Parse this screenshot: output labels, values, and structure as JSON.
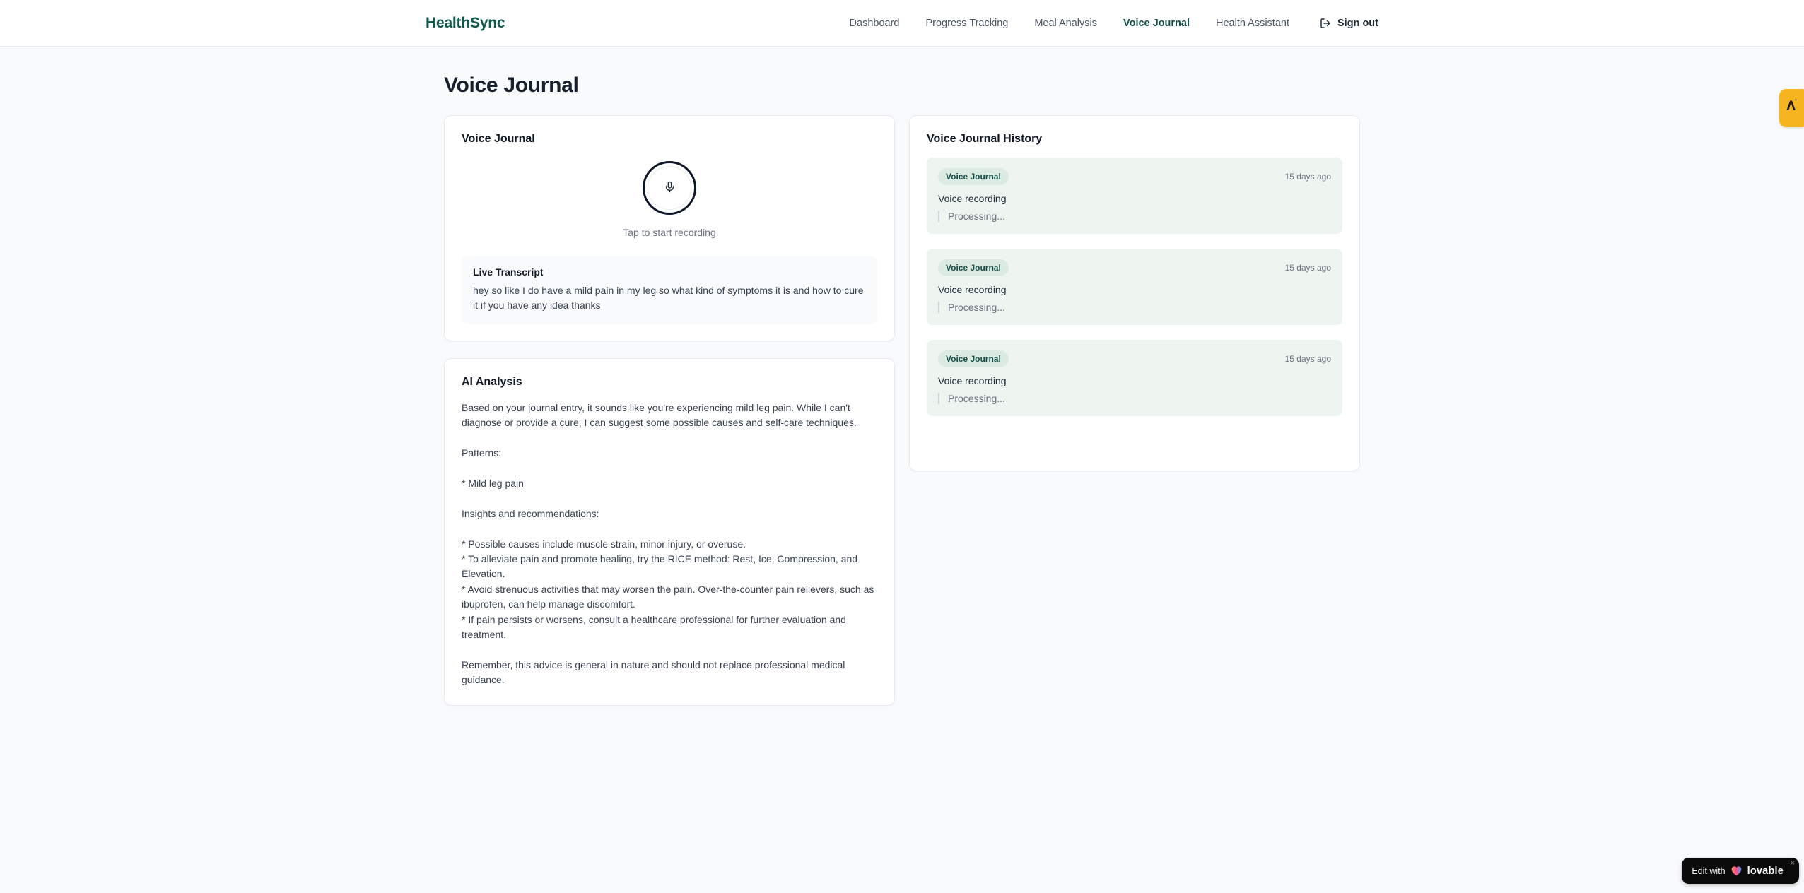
{
  "header": {
    "logo": "HealthSync",
    "nav": [
      {
        "label": "Dashboard"
      },
      {
        "label": "Progress Tracking"
      },
      {
        "label": "Meal Analysis"
      },
      {
        "label": "Voice Journal"
      },
      {
        "label": "Health Assistant"
      }
    ],
    "sign_out_label": "Sign out"
  },
  "page": {
    "title": "Voice Journal"
  },
  "recorder_card": {
    "title": "Voice Journal",
    "tap_hint": "Tap to start recording",
    "transcript": {
      "title": "Live Transcript",
      "text": "hey so like I do have a mild pain in my leg so what kind of symptoms it is and how to cure it if you have any idea thanks"
    }
  },
  "analysis_card": {
    "title": "AI Analysis",
    "body": "Based on your journal entry, it sounds like you're experiencing mild leg pain. While I can't diagnose or provide a cure, I can suggest some possible causes and self-care techniques.\n\nPatterns:\n\n* Mild leg pain\n\nInsights and recommendations:\n\n* Possible causes include muscle strain, minor injury, or overuse.\n* To alleviate pain and promote healing, try the RICE method: Rest, Ice, Compression, and Elevation.\n* Avoid strenuous activities that may worsen the pain. Over-the-counter pain relievers, such as ibuprofen, can help manage discomfort.\n* If pain persists or worsens, consult a healthcare professional for further evaluation and treatment.\n\nRemember, this advice is general in nature and should not replace professional medical guidance."
  },
  "history_card": {
    "title": "Voice Journal History",
    "entries": [
      {
        "badge": "Voice Journal",
        "timestamp": "15 days ago",
        "summary": "Voice recording",
        "status": "Processing..."
      },
      {
        "badge": "Voice Journal",
        "timestamp": "15 days ago",
        "summary": "Voice recording",
        "status": "Processing..."
      },
      {
        "badge": "Voice Journal",
        "timestamp": "15 days ago",
        "summary": "Voice recording",
        "status": "Processing..."
      }
    ]
  },
  "overlays": {
    "side_badge_glyph": "Λ",
    "lovable_badge": {
      "prefix": "Edit with",
      "brand": "lovable",
      "close": "×"
    }
  },
  "colors": {
    "brand_teal": "#0e5a4c",
    "active_nav": "#134e4a",
    "entry_bg": "#eef5f0",
    "badge_bg": "#dcebe2",
    "side_badge_yellow": "#f6b51f",
    "lovable_black": "#0b0b0c"
  }
}
